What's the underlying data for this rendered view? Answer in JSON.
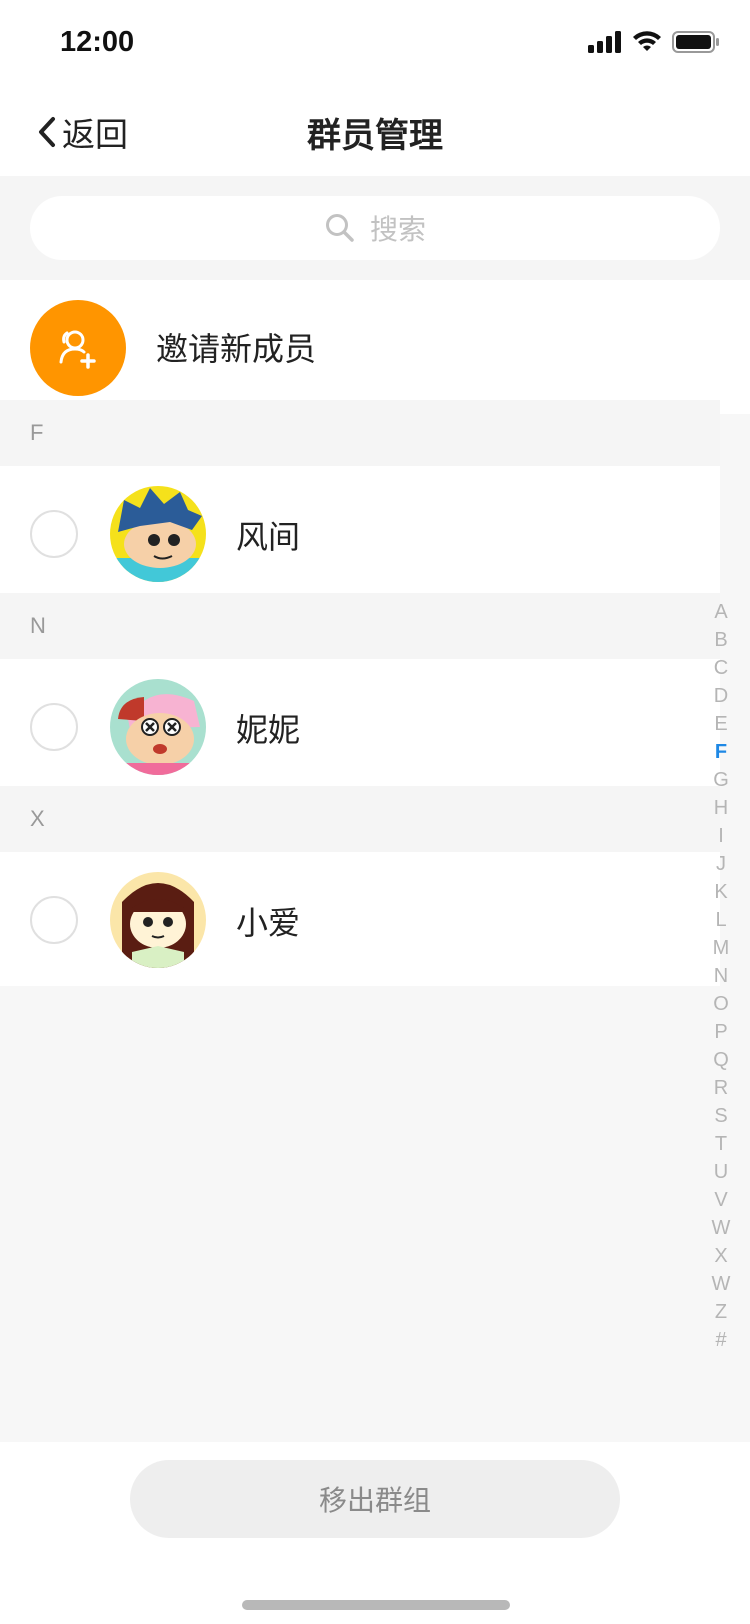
{
  "status_bar": {
    "time": "12:00"
  },
  "nav": {
    "back_label": "返回",
    "title": "群员管理"
  },
  "search": {
    "placeholder": "搜索"
  },
  "invite": {
    "label": "邀请新成员"
  },
  "sections": [
    {
      "letter": "F",
      "members": [
        {
          "name": "风间",
          "avatar": "kazama-avatar",
          "selected": false
        }
      ]
    },
    {
      "letter": "N",
      "members": [
        {
          "name": "妮妮",
          "avatar": "nene-avatar",
          "selected": false
        }
      ]
    },
    {
      "letter": "X",
      "members": [
        {
          "name": "小爱",
          "avatar": "ai-avatar",
          "selected": false
        }
      ]
    }
  ],
  "index_bar": {
    "letters": [
      "A",
      "B",
      "C",
      "D",
      "E",
      "F",
      "G",
      "H",
      "I",
      "J",
      "K",
      "L",
      "M",
      "N",
      "O",
      "P",
      "Q",
      "R",
      "S",
      "T",
      "U",
      "V",
      "W",
      "X",
      "W",
      "Z",
      "#"
    ],
    "active": "F",
    "active_color": "#1e88e5"
  },
  "footer": {
    "remove_label": "移出群组"
  },
  "colors": {
    "invite_avatar": "#ff9500",
    "accent": "#1e88e5"
  }
}
